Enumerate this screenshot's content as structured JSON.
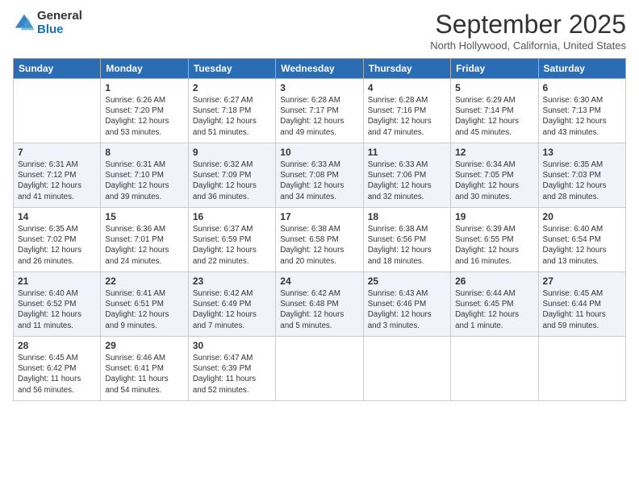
{
  "logo": {
    "general": "General",
    "blue": "Blue"
  },
  "title": "September 2025",
  "subtitle": "North Hollywood, California, United States",
  "days_of_week": [
    "Sunday",
    "Monday",
    "Tuesday",
    "Wednesday",
    "Thursday",
    "Friday",
    "Saturday"
  ],
  "weeks": [
    [
      {
        "day": "",
        "info": ""
      },
      {
        "day": "1",
        "info": "Sunrise: 6:26 AM\nSunset: 7:20 PM\nDaylight: 12 hours\nand 53 minutes."
      },
      {
        "day": "2",
        "info": "Sunrise: 6:27 AM\nSunset: 7:18 PM\nDaylight: 12 hours\nand 51 minutes."
      },
      {
        "day": "3",
        "info": "Sunrise: 6:28 AM\nSunset: 7:17 PM\nDaylight: 12 hours\nand 49 minutes."
      },
      {
        "day": "4",
        "info": "Sunrise: 6:28 AM\nSunset: 7:16 PM\nDaylight: 12 hours\nand 47 minutes."
      },
      {
        "day": "5",
        "info": "Sunrise: 6:29 AM\nSunset: 7:14 PM\nDaylight: 12 hours\nand 45 minutes."
      },
      {
        "day": "6",
        "info": "Sunrise: 6:30 AM\nSunset: 7:13 PM\nDaylight: 12 hours\nand 43 minutes."
      }
    ],
    [
      {
        "day": "7",
        "info": "Sunrise: 6:31 AM\nSunset: 7:12 PM\nDaylight: 12 hours\nand 41 minutes."
      },
      {
        "day": "8",
        "info": "Sunrise: 6:31 AM\nSunset: 7:10 PM\nDaylight: 12 hours\nand 39 minutes."
      },
      {
        "day": "9",
        "info": "Sunrise: 6:32 AM\nSunset: 7:09 PM\nDaylight: 12 hours\nand 36 minutes."
      },
      {
        "day": "10",
        "info": "Sunrise: 6:33 AM\nSunset: 7:08 PM\nDaylight: 12 hours\nand 34 minutes."
      },
      {
        "day": "11",
        "info": "Sunrise: 6:33 AM\nSunset: 7:06 PM\nDaylight: 12 hours\nand 32 minutes."
      },
      {
        "day": "12",
        "info": "Sunrise: 6:34 AM\nSunset: 7:05 PM\nDaylight: 12 hours\nand 30 minutes."
      },
      {
        "day": "13",
        "info": "Sunrise: 6:35 AM\nSunset: 7:03 PM\nDaylight: 12 hours\nand 28 minutes."
      }
    ],
    [
      {
        "day": "14",
        "info": "Sunrise: 6:35 AM\nSunset: 7:02 PM\nDaylight: 12 hours\nand 26 minutes."
      },
      {
        "day": "15",
        "info": "Sunrise: 6:36 AM\nSunset: 7:01 PM\nDaylight: 12 hours\nand 24 minutes."
      },
      {
        "day": "16",
        "info": "Sunrise: 6:37 AM\nSunset: 6:59 PM\nDaylight: 12 hours\nand 22 minutes."
      },
      {
        "day": "17",
        "info": "Sunrise: 6:38 AM\nSunset: 6:58 PM\nDaylight: 12 hours\nand 20 minutes."
      },
      {
        "day": "18",
        "info": "Sunrise: 6:38 AM\nSunset: 6:56 PM\nDaylight: 12 hours\nand 18 minutes."
      },
      {
        "day": "19",
        "info": "Sunrise: 6:39 AM\nSunset: 6:55 PM\nDaylight: 12 hours\nand 16 minutes."
      },
      {
        "day": "20",
        "info": "Sunrise: 6:40 AM\nSunset: 6:54 PM\nDaylight: 12 hours\nand 13 minutes."
      }
    ],
    [
      {
        "day": "21",
        "info": "Sunrise: 6:40 AM\nSunset: 6:52 PM\nDaylight: 12 hours\nand 11 minutes."
      },
      {
        "day": "22",
        "info": "Sunrise: 6:41 AM\nSunset: 6:51 PM\nDaylight: 12 hours\nand 9 minutes."
      },
      {
        "day": "23",
        "info": "Sunrise: 6:42 AM\nSunset: 6:49 PM\nDaylight: 12 hours\nand 7 minutes."
      },
      {
        "day": "24",
        "info": "Sunrise: 6:42 AM\nSunset: 6:48 PM\nDaylight: 12 hours\nand 5 minutes."
      },
      {
        "day": "25",
        "info": "Sunrise: 6:43 AM\nSunset: 6:46 PM\nDaylight: 12 hours\nand 3 minutes."
      },
      {
        "day": "26",
        "info": "Sunrise: 6:44 AM\nSunset: 6:45 PM\nDaylight: 12 hours\nand 1 minute."
      },
      {
        "day": "27",
        "info": "Sunrise: 6:45 AM\nSunset: 6:44 PM\nDaylight: 11 hours\nand 59 minutes."
      }
    ],
    [
      {
        "day": "28",
        "info": "Sunrise: 6:45 AM\nSunset: 6:42 PM\nDaylight: 11 hours\nand 56 minutes."
      },
      {
        "day": "29",
        "info": "Sunrise: 6:46 AM\nSunset: 6:41 PM\nDaylight: 11 hours\nand 54 minutes."
      },
      {
        "day": "30",
        "info": "Sunrise: 6:47 AM\nSunset: 6:39 PM\nDaylight: 11 hours\nand 52 minutes."
      },
      {
        "day": "",
        "info": ""
      },
      {
        "day": "",
        "info": ""
      },
      {
        "day": "",
        "info": ""
      },
      {
        "day": "",
        "info": ""
      }
    ]
  ]
}
